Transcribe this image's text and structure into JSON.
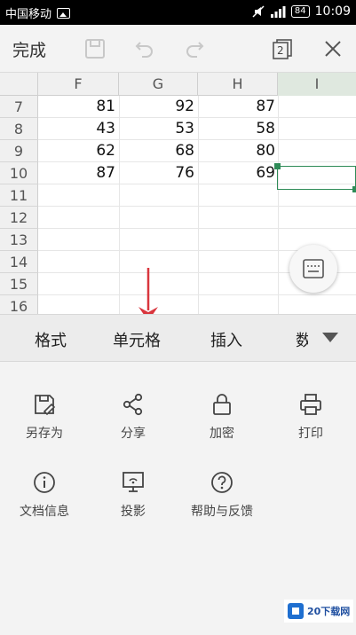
{
  "status_bar": {
    "carrier": "中国移动",
    "battery": "84",
    "time": "10:09"
  },
  "toolbar": {
    "done_label": "完成",
    "page_count": "2"
  },
  "sheet": {
    "columns": [
      "F",
      "G",
      "H",
      "I"
    ],
    "active_column": "I",
    "rows": [
      {
        "num": "7",
        "F": "81",
        "G": "92",
        "H": "87"
      },
      {
        "num": "8",
        "F": "43",
        "G": "53",
        "H": "58"
      },
      {
        "num": "9",
        "F": "62",
        "G": "68",
        "H": "80"
      },
      {
        "num": "10",
        "F": "87",
        "G": "76",
        "H": "69"
      },
      {
        "num": "11"
      },
      {
        "num": "12"
      },
      {
        "num": "13"
      },
      {
        "num": "14"
      },
      {
        "num": "15"
      },
      {
        "num": "16"
      }
    ]
  },
  "tabs": [
    "格式",
    "单元格",
    "插入",
    "数"
  ],
  "menu": {
    "items": [
      {
        "label": "另存为",
        "icon": "save-as-icon"
      },
      {
        "label": "分享",
        "icon": "share-icon"
      },
      {
        "label": "加密",
        "icon": "lock-icon"
      },
      {
        "label": "打印",
        "icon": "printer-icon"
      },
      {
        "label": "文档信息",
        "icon": "info-icon"
      },
      {
        "label": "投影",
        "icon": "projection-icon"
      },
      {
        "label": "帮助与反馈",
        "icon": "help-icon"
      }
    ]
  },
  "watermark": {
    "text": "20下载网"
  },
  "colors": {
    "accent_green": "#2e8b57",
    "arrow_red": "#d9363e"
  }
}
